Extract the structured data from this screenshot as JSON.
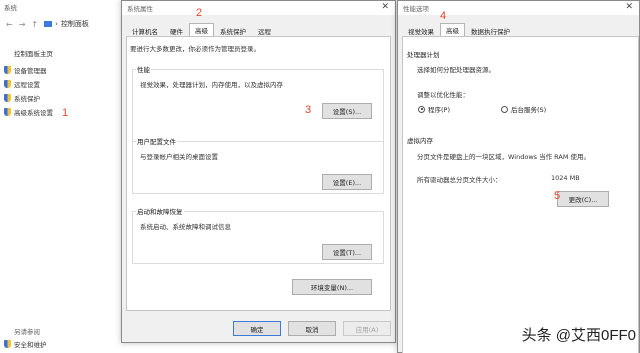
{
  "bg_window": {
    "title": "系统",
    "breadcrumb": "控制面板",
    "side_home": "控制面板主页",
    "side_links": [
      "设备管理器",
      "远程设置",
      "系统保护",
      "高级系统设置"
    ],
    "see_also": "另请参阅",
    "security": "安全和维护"
  },
  "sys_props": {
    "title": "系统属性",
    "tabs": [
      "计算机名",
      "硬件",
      "高级",
      "系统保护",
      "远程"
    ],
    "admin_note": "要进行大多数更改，你必须作为管理员登录。",
    "perf": {
      "title": "性能",
      "desc": "视觉效果，处理器计划，内存使用，以及虚拟内存",
      "button": "设置(S)..."
    },
    "profile": {
      "title": "用户配置文件",
      "desc": "与登录帐户相关的桌面设置",
      "button": "设置(E)..."
    },
    "startup": {
      "title": "启动和故障恢复",
      "desc": "系统启动、系统故障和调试信息",
      "button": "设置(T)..."
    },
    "env_button": "环境变量(N)...",
    "ok": "确定",
    "cancel": "取消",
    "apply": "应用(A)"
  },
  "perf_opts": {
    "title": "性能选项",
    "tabs": [
      "视觉效果",
      "高级",
      "数据执行保护"
    ],
    "sched": {
      "title": "处理器计划",
      "desc": "选择如何分配处理器资源。",
      "adjust": "调整以优化性能：",
      "opt1": "程序(P)",
      "opt2": "后台服务(S)"
    },
    "vm": {
      "title": "虚拟内存",
      "desc": "分页文件是硬盘上的一块区域，Windows 当作 RAM 使用。",
      "total_label": "所有驱动器总分页文件大小：",
      "total_value": "1024 MB",
      "button": "更改(C)..."
    }
  },
  "annotations": [
    "1",
    "2",
    "3",
    "4",
    "5"
  ],
  "watermark": "头条 @艾西0FF0"
}
